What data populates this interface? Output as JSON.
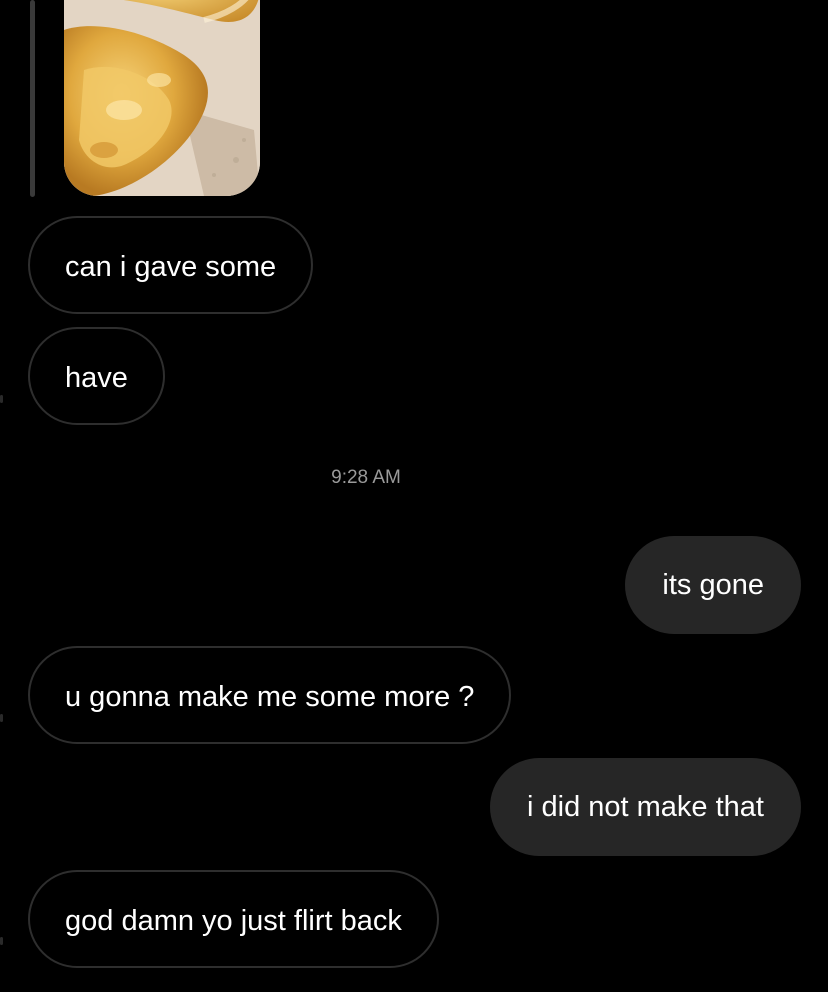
{
  "conversation": {
    "timestamp": "9:28 AM",
    "messages_before_time": [
      {
        "text": "can i gave some",
        "direction": "incoming"
      },
      {
        "text": "have",
        "direction": "incoming"
      }
    ],
    "messages_after_time": [
      {
        "text": "its gone",
        "direction": "outgoing"
      },
      {
        "text": "u gonna make me some more ?",
        "direction": "incoming"
      },
      {
        "text": "i did not make that",
        "direction": "outgoing"
      },
      {
        "text": "god damn yo just flirt back",
        "direction": "incoming"
      }
    ]
  },
  "attachment": {
    "kind": "photo",
    "depicts": "fried chicken"
  },
  "colors": {
    "background": "#000000",
    "incoming_bubble_border": "#2e2e2e",
    "outgoing_bubble": "#262626",
    "text": "#ffffff",
    "timestamp": "#9a9a9a"
  }
}
